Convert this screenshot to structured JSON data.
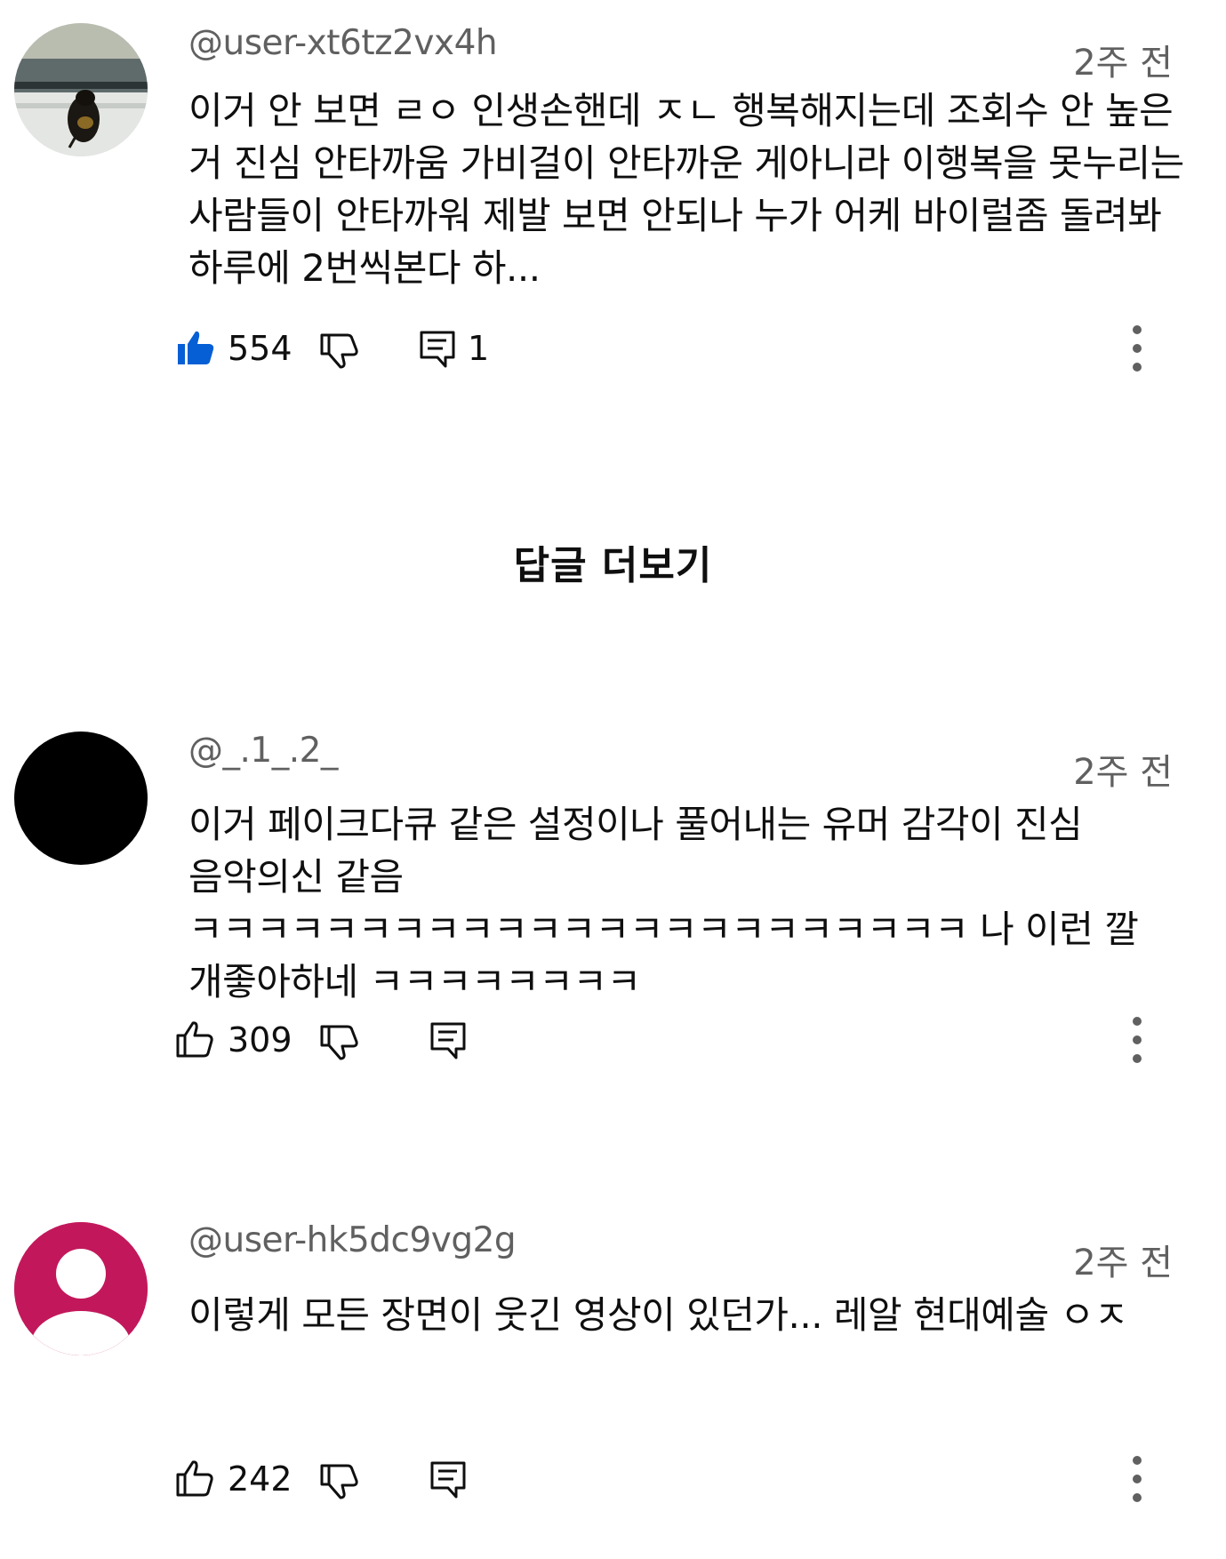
{
  "comments": [
    {
      "author": "@user-xt6tz2vx4h",
      "time": "2주 전",
      "text": "이거 안 보면 ㄹㅇ 인생손핸데 ㅈㄴ 행복해지는데 조회수 안 높은 거 진심 안타까움 가비걸이 안타까운 게아니라 이행복을 못누리는 사람들이 안타까워 제발 보면 안되나 누가 어케 바이럴좀 돌려봐 하루에 2번씩본다 하...",
      "likes": "554",
      "replies": "1",
      "liked": true,
      "avatar": "bee-on-window-photo"
    },
    {
      "author": "@_.1_.2_",
      "time": "2주 전",
      "text": "이거 페이크다큐 같은 설정이나 풀어내는 유머 감각이 진심 음악의신 같음 ㅋㅋㅋㅋㅋㅋㅋㅋㅋㅋㅋㅋㅋㅋㅋㅋㅋㅋㅋㅋㅋㅋㅋ 나 이런 깔 개좋아하네 ㅋㅋㅋㅋㅋㅋㅋㅋ",
      "likes": "309",
      "liked": false,
      "avatar": "black-circle"
    },
    {
      "author": "@user-hk5dc9vg2g",
      "time": "2주 전",
      "text": "이렇게 모든 장면이 웃긴 영상이 있던가... 레알 현대예술 ㅇㅈ",
      "likes": "242",
      "liked": false,
      "avatar": "default-person-magenta"
    }
  ],
  "show_replies_label": "답글 더보기",
  "colors": {
    "like_active": "#065fd4",
    "secondary_text": "#606060",
    "avatar_magenta": "#c2185b"
  },
  "icons": [
    "thumbs-up-icon",
    "thumbs-down-icon",
    "reply-icon",
    "more-vert-icon"
  ]
}
